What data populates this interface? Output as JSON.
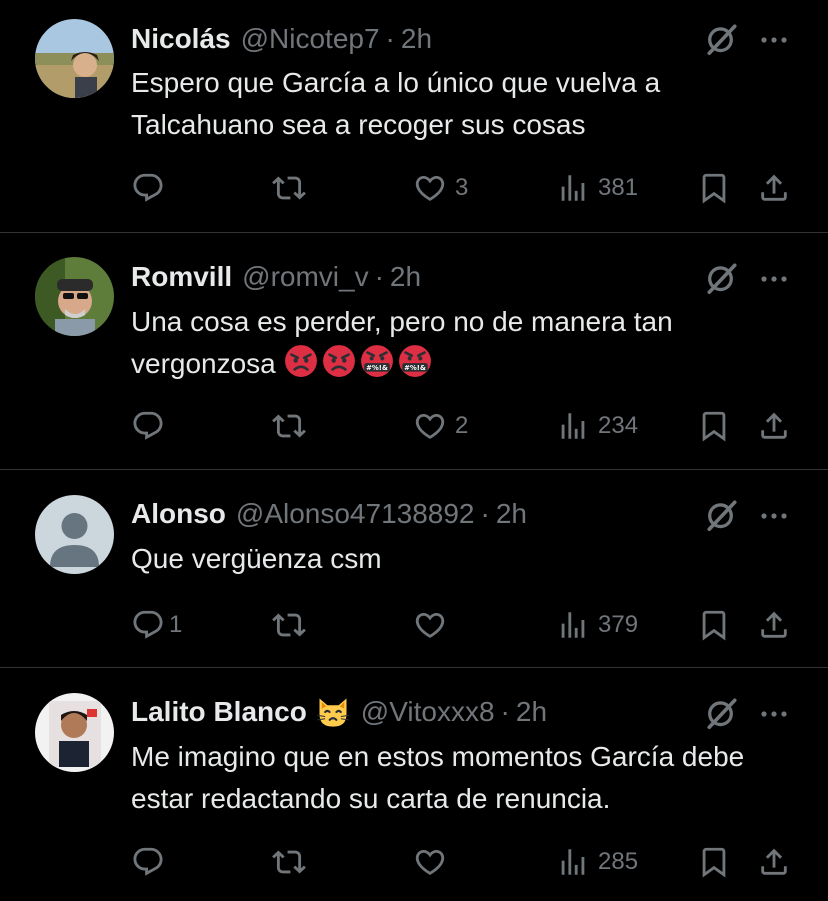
{
  "tweets": [
    {
      "name": "Nicolás",
      "handle": "@Nicotep7",
      "time": "2h",
      "text": "Espero que García a lo único que vuelva a Talcahuano sea a recoger sus cosas",
      "replies": "",
      "likes": "3",
      "views": "381"
    },
    {
      "name": "Romvill",
      "handle": "@romvi_v",
      "time": "2h",
      "text": "Una cosa es perder, pero no de manera tan vergonzosa",
      "emoji_row": [
        "angry-face",
        "angry-face",
        "cursing-face",
        "cursing-face"
      ],
      "replies": "",
      "likes": "2",
      "views": "234"
    },
    {
      "name": "Alonso",
      "handle": "@Alonso47138892",
      "time": "2h",
      "text": "Que vergüenza csm",
      "replies": "1",
      "likes": "",
      "views": "379"
    },
    {
      "name": "Lalito Blanco",
      "name_emoji": "cat-face",
      "handle": "@Vitoxxx8",
      "time": "2h",
      "text": "Me imagino que en estos momentos García debe estar redactando su carta de renuncia.",
      "replies": "",
      "likes": "",
      "views": "285"
    }
  ],
  "separator": "·",
  "colors": {
    "background": "#000000",
    "text": "#e7e9ea",
    "muted": "#71767b",
    "divider": "#2f3336"
  },
  "icons": [
    "reply-icon",
    "retweet-icon",
    "like-icon",
    "views-icon",
    "bookmark-icon",
    "share-icon",
    "grok-icon",
    "more-icon"
  ]
}
